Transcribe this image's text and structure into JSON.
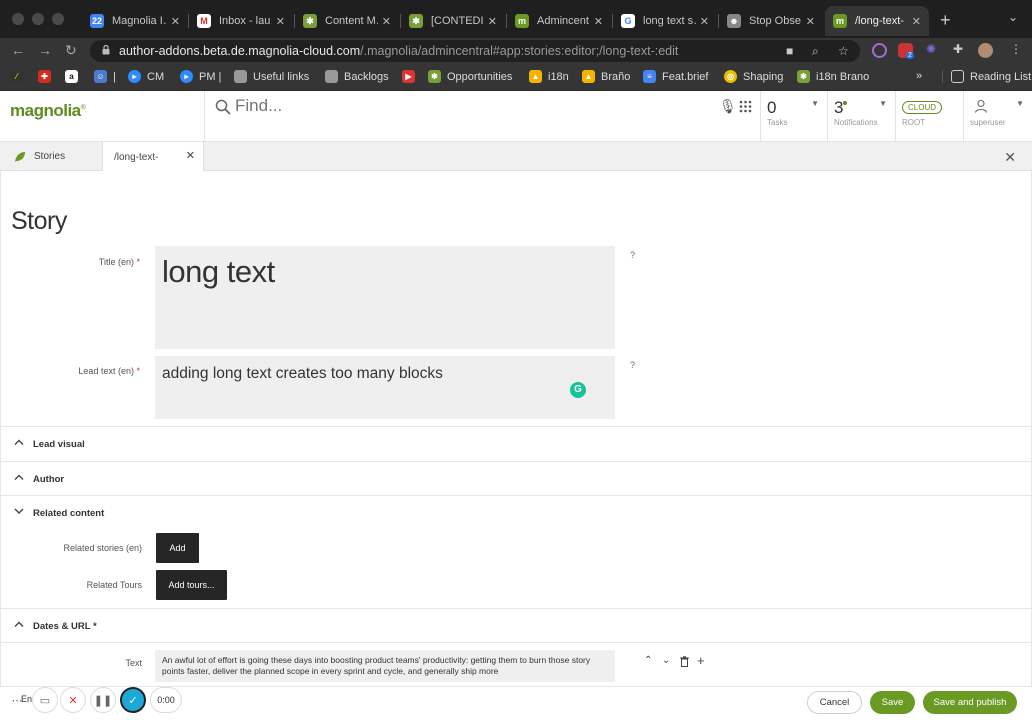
{
  "browser": {
    "tabs": [
      {
        "title": "Magnolia I…",
        "icon": "calendar-icon",
        "color": "#4285f4"
      },
      {
        "title": "Inbox - lau…",
        "icon": "gmail-icon",
        "color": "#d93025"
      },
      {
        "title": "Content M…",
        "icon": "confluence-icon",
        "color": "#7a9f3a"
      },
      {
        "title": "[CONTEDI…",
        "icon": "jira-icon",
        "color": "#7a9f3a"
      },
      {
        "title": "Admincent…",
        "icon": "magnolia-icon",
        "color": "#6a9a23"
      },
      {
        "title": "long text s…",
        "icon": "google-icon",
        "color": "#4285f4"
      },
      {
        "title": "Stop Obse…",
        "icon": "avatar-icon",
        "color": "#888888"
      },
      {
        "title": "/long-text-",
        "icon": "magnolia-icon",
        "color": "#6a9a23"
      }
    ],
    "url_domain": "author-addons.beta.de.magnolia-cloud.com",
    "url_path": "/.magnolia/admincentral#app:stories:editor;/long-text-:edit",
    "extension_badge": "2",
    "bookmarks": [
      {
        "label": "",
        "icon": "bookmark-icon-1"
      },
      {
        "label": "",
        "icon": "swiss-icon"
      },
      {
        "label": "",
        "icon": "amazon-icon"
      },
      {
        "label": "|",
        "icon": "contacts-icon"
      },
      {
        "label": "CM",
        "icon": "zoom-icon"
      },
      {
        "label": "PM |",
        "icon": "zoom-icon"
      },
      {
        "label": "Useful links",
        "icon": "folder-icon"
      },
      {
        "label": "Backlogs",
        "icon": "folder-icon"
      },
      {
        "label": "",
        "icon": "flag-icon"
      },
      {
        "label": "Opportunities",
        "icon": "jira-icon"
      },
      {
        "label": "i18n",
        "icon": "drive-icon"
      },
      {
        "label": "Braño",
        "icon": "drive-icon"
      },
      {
        "label": "Feat.brief",
        "icon": "docs-icon"
      },
      {
        "label": "Shaping",
        "icon": "shaping-icon"
      },
      {
        "label": "i18n Brano",
        "icon": "jira-icon"
      }
    ],
    "more": "»",
    "reading_list": "Reading List"
  },
  "header": {
    "logo": "magnolia",
    "search_placeholder": "Find...",
    "tasks": {
      "count": "0",
      "label": "Tasks"
    },
    "notifications": {
      "count": "3",
      "label": "Notifications"
    },
    "environment": {
      "badge": "CLOUD",
      "label": "ROOT"
    },
    "user": {
      "label": "superuser"
    }
  },
  "apptabs": {
    "app": "Stories",
    "editor": "/long-text-"
  },
  "editor": {
    "heading": "Story",
    "title_label": "Title (en)",
    "title_value": "long text",
    "lead_label": "Lead text (en)",
    "lead_value": "adding long text creates too many blocks",
    "help_mark": "?",
    "required_mark": "*",
    "sections": {
      "lead_visual": "Lead visual",
      "author": "Author",
      "related_content": "Related content",
      "dates_url": "Dates & URL *"
    },
    "related_stories_label": "Related stories (en)",
    "add_label": "Add",
    "related_tours_label": "Related Tours",
    "add_tours_label": "Add tours...",
    "text_label": "Text",
    "text_value": "An awful lot of effort is going these days into boosting product teams' productivity: getting them to burn those story points faster, deliver the planned scope in every sprint and cycle, and generally ship more"
  },
  "footer": {
    "cancel": "Cancel",
    "save": "Save",
    "save_publish": "Save and publish",
    "timer": "0:00",
    "lang": "En"
  }
}
